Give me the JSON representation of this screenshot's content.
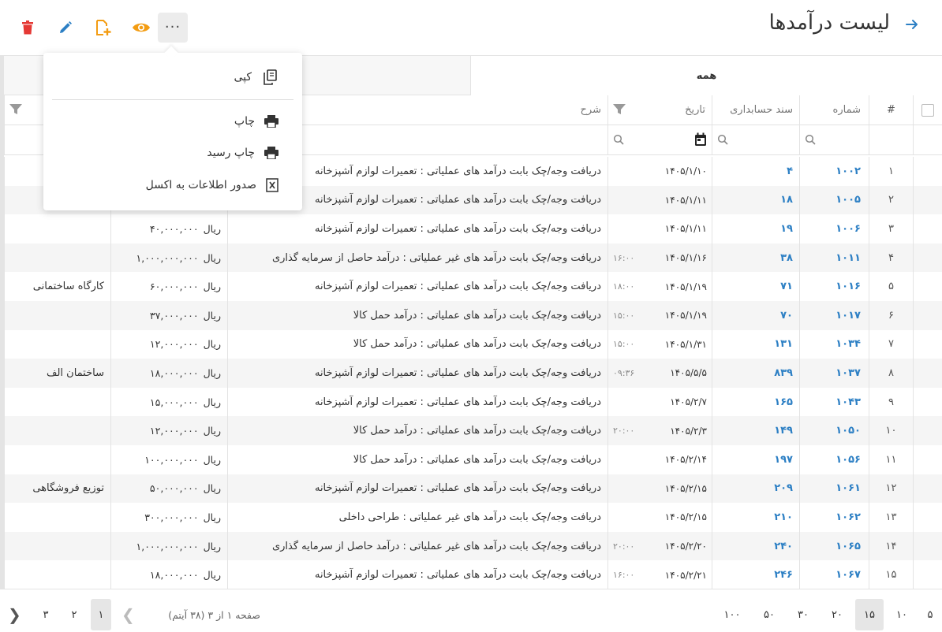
{
  "header": {
    "title": "لیست درآمدها",
    "more_label": "···",
    "colors": {
      "accent": "#2c7fc4",
      "delete": "#e53935",
      "add": "#f39c12",
      "view": "#f39c12"
    }
  },
  "menu": {
    "items": [
      {
        "label": "کپی",
        "icon": "copy-icon"
      },
      {
        "label": "چاپ",
        "icon": "printer-icon"
      },
      {
        "label": "چاپ رسید",
        "icon": "printer-icon"
      },
      {
        "label": "صدور اطلاعات به اکسل",
        "icon": "excel-icon"
      }
    ]
  },
  "tabs": {
    "all": "همه"
  },
  "columns": {
    "index": "#",
    "number": "شماره",
    "doc": "سند حسابداری",
    "date": "تاریخ",
    "desc": "شرح"
  },
  "rows": [
    {
      "idx": "۱",
      "num": "۱۰۰۲",
      "doc": "۴",
      "date": "۱۴۰۵/۱/۱۰",
      "time": "",
      "desc": "دریافت وجه/چک بابت درآمد های عملیاتی : تعمیرات لوازم آشپزخانه",
      "unit": "",
      "amount": "",
      "project": "ی"
    },
    {
      "idx": "۲",
      "num": "۱۰۰۵",
      "doc": "۱۸",
      "date": "۱۴۰۵/۱/۱۱",
      "time": "",
      "desc": "دریافت وجه/چک بابت درآمد های عملیاتی : تعمیرات لوازم آشپزخانه",
      "unit": "",
      "amount": "",
      "project": ""
    },
    {
      "idx": "۳",
      "num": "۱۰۰۶",
      "doc": "۱۹",
      "date": "۱۴۰۵/۱/۱۱",
      "time": "",
      "desc": "دریافت وجه/چک بابت درآمد های عملیاتی : تعمیرات لوازم آشپزخانه",
      "unit": "ریال",
      "amount": "۴۰,۰۰۰,۰۰۰",
      "project": ""
    },
    {
      "idx": "۴",
      "num": "۱۰۱۱",
      "doc": "۳۸",
      "date": "۱۴۰۵/۱/۱۶",
      "time": "۱۶:۰۰",
      "desc": "دریافت وجه/چک بابت درآمد های غیر عملیاتی : درآمد حاصل از سرمایه گذاری",
      "unit": "ریال",
      "amount": "۱,۰۰۰,۰۰۰,۰۰۰",
      "project": ""
    },
    {
      "idx": "۵",
      "num": "۱۰۱۶",
      "doc": "۷۱",
      "date": "۱۴۰۵/۱/۱۹",
      "time": "۱۸:۰۰",
      "desc": "دریافت وجه/چک بابت درآمد های عملیاتی : تعمیرات لوازم آشپزخانه",
      "unit": "ریال",
      "amount": "۶۰,۰۰۰,۰۰۰",
      "project": "کارگاه ساختمانی"
    },
    {
      "idx": "۶",
      "num": "۱۰۱۷",
      "doc": "۷۰",
      "date": "۱۴۰۵/۱/۱۹",
      "time": "۱۵:۰۰",
      "desc": "دریافت وجه/چک بابت درآمد های عملیاتی : درآمد حمل کالا",
      "unit": "ریال",
      "amount": "۳۷,۰۰۰,۰۰۰",
      "project": ""
    },
    {
      "idx": "۷",
      "num": "۱۰۳۴",
      "doc": "۱۳۱",
      "date": "۱۴۰۵/۱/۳۱",
      "time": "۱۵:۰۰",
      "desc": "دریافت وجه/چک بابت درآمد های عملیاتی : درآمد حمل کالا",
      "unit": "ریال",
      "amount": "۱۲,۰۰۰,۰۰۰",
      "project": ""
    },
    {
      "idx": "۸",
      "num": "۱۰۳۷",
      "doc": "۸۳۹",
      "date": "۱۴۰۵/۵/۵",
      "time": "۰۹:۳۶",
      "desc": "دریافت وجه/چک بابت درآمد های عملیاتی : تعمیرات لوازم آشپزخانه",
      "unit": "ریال",
      "amount": "۱۸,۰۰۰,۰۰۰",
      "project": "ساختمان الف"
    },
    {
      "idx": "۹",
      "num": "۱۰۴۳",
      "doc": "۱۶۵",
      "date": "۱۴۰۵/۲/۷",
      "time": "",
      "desc": "دریافت وجه/چک بابت درآمد های عملیاتی : تعمیرات لوازم آشپزخانه",
      "unit": "ریال",
      "amount": "۱۵,۰۰۰,۰۰۰",
      "project": ""
    },
    {
      "idx": "۱۰",
      "num": "۱۰۵۰",
      "doc": "۱۴۹",
      "date": "۱۴۰۵/۲/۳",
      "time": "۲۰:۰۰",
      "desc": "دریافت وجه/چک بابت درآمد های عملیاتی : درآمد حمل کالا",
      "unit": "ریال",
      "amount": "۱۲,۰۰۰,۰۰۰",
      "project": ""
    },
    {
      "idx": "۱۱",
      "num": "۱۰۵۶",
      "doc": "۱۹۷",
      "date": "۱۴۰۵/۲/۱۴",
      "time": "",
      "desc": "دریافت وجه/چک بابت درآمد های عملیاتی : درآمد حمل کالا",
      "unit": "ریال",
      "amount": "۱۰۰,۰۰۰,۰۰۰",
      "project": ""
    },
    {
      "idx": "۱۲",
      "num": "۱۰۶۱",
      "doc": "۲۰۹",
      "date": "۱۴۰۵/۲/۱۵",
      "time": "",
      "desc": "دریافت وجه/چک بابت درآمد های عملیاتی : تعمیرات لوازم آشپزخانه",
      "unit": "ریال",
      "amount": "۵۰,۰۰۰,۰۰۰",
      "project": "توزیع فروشگاهی"
    },
    {
      "idx": "۱۳",
      "num": "۱۰۶۲",
      "doc": "۲۱۰",
      "date": "۱۴۰۵/۲/۱۵",
      "time": "",
      "desc": "دریافت وجه/چک بابت درآمد های غیر عملیاتی : طراحی داخلی",
      "unit": "ریال",
      "amount": "۳۰۰,۰۰۰,۰۰۰",
      "project": ""
    },
    {
      "idx": "۱۴",
      "num": "۱۰۶۵",
      "doc": "۲۴۰",
      "date": "۱۴۰۵/۲/۲۰",
      "time": "۲۰:۰۰",
      "desc": "دریافت وجه/چک بابت درآمد های غیر عملیاتی : درآمد حاصل از سرمایه گذاری",
      "unit": "ریال",
      "amount": "۱,۰۰۰,۰۰۰,۰۰۰",
      "project": ""
    },
    {
      "idx": "۱۵",
      "num": "۱۰۶۷",
      "doc": "۲۴۶",
      "date": "۱۴۰۵/۲/۲۱",
      "time": "۱۶:۰۰",
      "desc": "دریافت وجه/چک بابت درآمد های عملیاتی : تعمیرات لوازم آشپزخانه",
      "unit": "ریال",
      "amount": "۱۸,۰۰۰,۰۰۰",
      "project": ""
    }
  ],
  "pager": {
    "sizes": [
      "۵",
      "۱۰",
      "۱۵",
      "۲۰",
      "۳۰",
      "۵۰",
      "۱۰۰"
    ],
    "selected_size": "۱۵",
    "info": "صفحه ۱ از ۳ (۳۸ آیتم)",
    "pages": [
      "۱",
      "۲",
      "۳"
    ],
    "current_page": "۱"
  }
}
